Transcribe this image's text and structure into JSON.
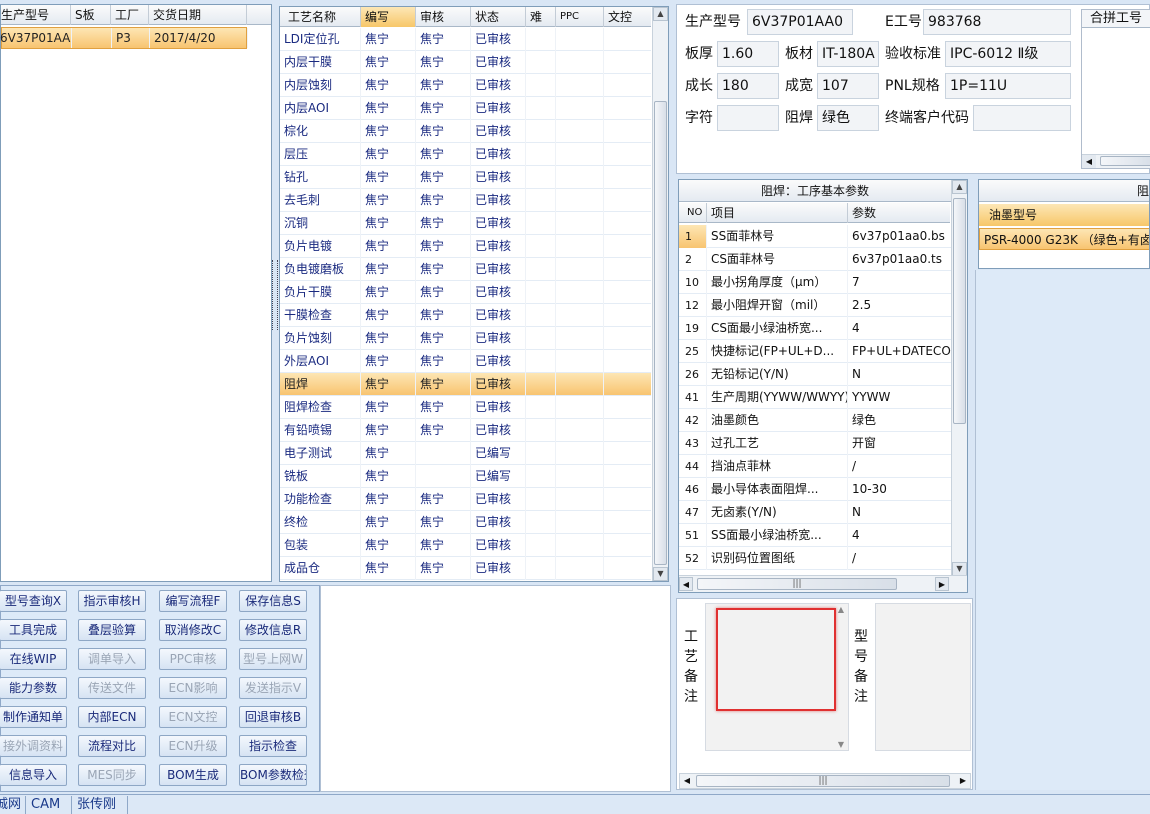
{
  "model_list": {
    "columns": [
      "生产型号",
      "S板",
      "工厂",
      "交货日期"
    ],
    "rows": [
      {
        "model": "6V37P01AA0",
        "s_board": "",
        "factory": "P3",
        "date": "2017/4/20"
      }
    ]
  },
  "process_grid": {
    "columns": [
      "工艺名称",
      "编写",
      "审核",
      "状态",
      "难",
      "PPC",
      "文控"
    ],
    "rows": [
      {
        "name": "LDI定位孔",
        "writer": "焦宁",
        "reviewer": "焦宁",
        "status": "已审核"
      },
      {
        "name": "内层干膜",
        "writer": "焦宁",
        "reviewer": "焦宁",
        "status": "已审核"
      },
      {
        "name": "内层蚀刻",
        "writer": "焦宁",
        "reviewer": "焦宁",
        "status": "已审核"
      },
      {
        "name": "内层AOI",
        "writer": "焦宁",
        "reviewer": "焦宁",
        "status": "已审核"
      },
      {
        "name": "棕化",
        "writer": "焦宁",
        "reviewer": "焦宁",
        "status": "已审核"
      },
      {
        "name": "层压",
        "writer": "焦宁",
        "reviewer": "焦宁",
        "status": "已审核"
      },
      {
        "name": "钻孔",
        "writer": "焦宁",
        "reviewer": "焦宁",
        "status": "已审核"
      },
      {
        "name": "去毛刺",
        "writer": "焦宁",
        "reviewer": "焦宁",
        "status": "已审核"
      },
      {
        "name": "沉铜",
        "writer": "焦宁",
        "reviewer": "焦宁",
        "status": "已审核"
      },
      {
        "name": "负片电镀",
        "writer": "焦宁",
        "reviewer": "焦宁",
        "status": "已审核"
      },
      {
        "name": "负电镀磨板",
        "writer": "焦宁",
        "reviewer": "焦宁",
        "status": "已审核"
      },
      {
        "name": "负片干膜",
        "writer": "焦宁",
        "reviewer": "焦宁",
        "status": "已审核"
      },
      {
        "name": "干膜检查",
        "writer": "焦宁",
        "reviewer": "焦宁",
        "status": "已审核"
      },
      {
        "name": "负片蚀刻",
        "writer": "焦宁",
        "reviewer": "焦宁",
        "status": "已审核"
      },
      {
        "name": "外层AOI",
        "writer": "焦宁",
        "reviewer": "焦宁",
        "status": "已审核"
      },
      {
        "name": "阻焊",
        "writer": "焦宁",
        "reviewer": "焦宁",
        "status": "已审核"
      },
      {
        "name": "阻焊检查",
        "writer": "焦宁",
        "reviewer": "焦宁",
        "status": "已审核"
      },
      {
        "name": "有铅喷锡",
        "writer": "焦宁",
        "reviewer": "焦宁",
        "status": "已审核"
      },
      {
        "name": "电子测试",
        "writer": "焦宁",
        "reviewer": "",
        "status": "已编写"
      },
      {
        "name": "铣板",
        "writer": "焦宁",
        "reviewer": "",
        "status": "已编写"
      },
      {
        "name": "功能检查",
        "writer": "焦宁",
        "reviewer": "焦宁",
        "status": "已审核"
      },
      {
        "name": "终检",
        "writer": "焦宁",
        "reviewer": "焦宁",
        "status": "已审核"
      },
      {
        "name": "包装",
        "writer": "焦宁",
        "reviewer": "焦宁",
        "status": "已审核"
      },
      {
        "name": "成品仓",
        "writer": "焦宁",
        "reviewer": "焦宁",
        "status": "已审核"
      }
    ],
    "selected_index": 15
  },
  "buttons": [
    [
      "型号查询X",
      "指示审核H",
      "编写流程F",
      "保存信息S"
    ],
    [
      "工具完成",
      "叠层验算",
      "取消修改C",
      "修改信息R"
    ],
    [
      "在线WIP",
      "调单导入",
      "PPC审核",
      "型号上网W"
    ],
    [
      "能力参数",
      "传送文件",
      "ECN影响",
      "发送指示V"
    ],
    [
      "制作通知单",
      "内部ECN",
      "ECN文控",
      "回退审核B"
    ],
    [
      "接外调资料",
      "流程对比",
      "ECN升级",
      "指示检查"
    ],
    [
      "信息导入",
      "MES同步",
      "BOM生成",
      "BOM参数检查"
    ]
  ],
  "buttons_disabled": [
    [
      false,
      false,
      false,
      false
    ],
    [
      false,
      false,
      false,
      false
    ],
    [
      false,
      true,
      true,
      true
    ],
    [
      false,
      true,
      true,
      true
    ],
    [
      false,
      false,
      true,
      false
    ],
    [
      true,
      false,
      true,
      false
    ],
    [
      false,
      true,
      false,
      false
    ]
  ],
  "info": {
    "model_label": "生产型号",
    "model_value": "6V37P01AA0",
    "e_label": "E工号",
    "e_value": "983768",
    "merge_label": "合拼工号",
    "thickness_label": "板厚",
    "thickness_value": "1.60",
    "material_label": "板材",
    "material_value": "IT-180A",
    "accept_label": "验收标准",
    "accept_value": "IPC-6012 Ⅱ级",
    "len_label": "成长",
    "len_value": "180",
    "width_label": "成宽",
    "width_value": "107",
    "pnl_label": "PNL规格",
    "pnl_value": "1P=11U",
    "char_label": "字符",
    "char_value": "",
    "mask_label": "阻焊",
    "mask_value": "绿色",
    "customer_label": "终端客户代码",
    "customer_value": ""
  },
  "params": {
    "title": "阻焊：工序基本参数",
    "columns": [
      "NO",
      "项目",
      "参数"
    ],
    "rows": [
      {
        "no": "1",
        "item": "SS面菲林号",
        "value": "6v37p01aa0.bs"
      },
      {
        "no": "2",
        "item": "CS面菲林号",
        "value": "6v37p01aa0.ts"
      },
      {
        "no": "10",
        "item": "最小拐角厚度（μm）",
        "value": "7"
      },
      {
        "no": "12",
        "item": "最小阻焊开窗（mil）",
        "value": "2.5"
      },
      {
        "no": "19",
        "item": "CS面最小绿油桥宽...",
        "value": "4"
      },
      {
        "no": "25",
        "item": "快捷标记(FP+UL+D...",
        "value": "FP+UL+DATECODE"
      },
      {
        "no": "26",
        "item": "无铅标记(Y/N)",
        "value": "N"
      },
      {
        "no": "41",
        "item": "生产周期(YYWW/WWYY)",
        "value": "YYWW"
      },
      {
        "no": "42",
        "item": "油墨颜色",
        "value": "绿色"
      },
      {
        "no": "43",
        "item": "过孔工艺",
        "value": "开窗"
      },
      {
        "no": "44",
        "item": "挡油点菲林",
        "value": "/"
      },
      {
        "no": "46",
        "item": "最小导体表面阻焊...",
        "value": "10-30"
      },
      {
        "no": "47",
        "item": "无卤素(Y/N)",
        "value": "N"
      },
      {
        "no": "51",
        "item": "SS面最小绿油桥宽...",
        "value": "4"
      },
      {
        "no": "52",
        "item": "识别码位置图纸",
        "value": "/"
      }
    ],
    "selected_index": 0
  },
  "ink": {
    "title": "阻焊",
    "column": "油墨型号",
    "value": "PSR-4000 G23K （绿色+有卤"
  },
  "notes": {
    "process_label": [
      "工",
      "艺",
      "备",
      "注"
    ],
    "model_label": [
      "型",
      "号",
      "备",
      "注"
    ]
  },
  "status_bar": [
    "诚网",
    "CAM",
    "张传刚"
  ],
  "icons": {
    "up": "▲",
    "down": "▼",
    "left": "◀",
    "right": "▶",
    "grip": "|||"
  }
}
